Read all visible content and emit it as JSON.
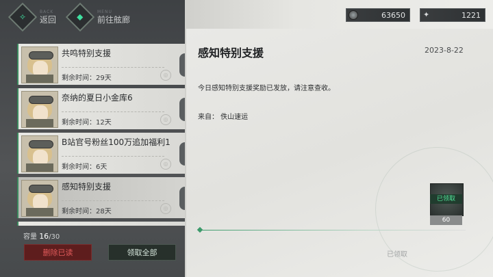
{
  "nav": {
    "back": {
      "sub": "BACK",
      "label": "返回"
    },
    "menu": {
      "sub": "MENU",
      "label": "前往舷廊"
    }
  },
  "currency": [
    {
      "icon": "coin-icon",
      "value": "63650"
    },
    {
      "icon": "crystal-icon",
      "value": "1221"
    }
  ],
  "mails": [
    {
      "title": "共鸣特别支援",
      "remaining": "剩余时间：29天"
    },
    {
      "title": "奈纳的夏日小金库6",
      "remaining": "剩余时间：12天"
    },
    {
      "title": "B站官号粉丝100万追加福利1",
      "remaining": "剩余时间：6天"
    },
    {
      "title": "感知特别支援",
      "remaining": "剩余时间：28天"
    }
  ],
  "capacity": {
    "label": "容量",
    "used": "16",
    "total": "/30"
  },
  "buttons": {
    "delete_read": "删除已读",
    "claim_all": "领取全部"
  },
  "detail": {
    "title": "感知特别支援",
    "date": "2023-8-22",
    "body": "今日感知特别支援奖励已发放，请注意查收。",
    "from": "来自：  佚山速运",
    "reward": {
      "badge": "已领取",
      "count": "60"
    },
    "status": "已领取"
  },
  "colors": {
    "accent": "#3b9a6a",
    "delete": "#e05a5a"
  }
}
